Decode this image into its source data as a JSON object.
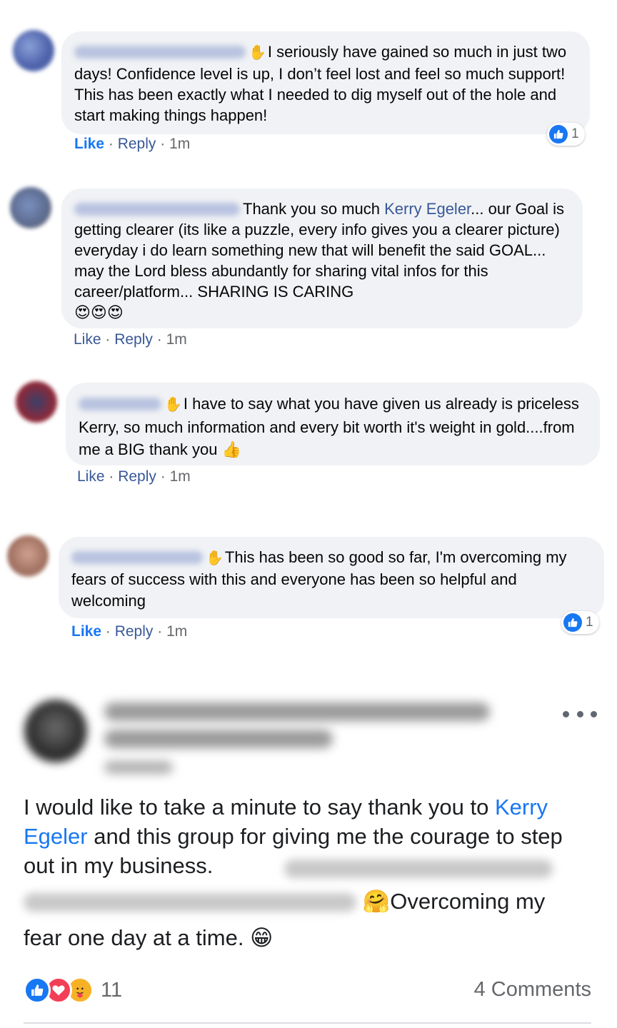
{
  "comments": [
    {
      "text": "I seriously have gained so much in just two days! Confidence level is up, I don’t feel lost and feel so much support! This has been exactly what I needed to dig myself out of the hole and start making things happen!",
      "like_label": "Like",
      "reply_label": "Reply",
      "time": "1m",
      "reaction_count": "1"
    },
    {
      "text_before": "Thank you so much ",
      "mention": "Kerry Egeler",
      "text_after": "... our Goal is getting clearer (its like a puzzle, every info gives you a clearer picture) everyday i do learn something new that will benefit the said GOAL... may the Lord bless abundantly for sharing vital infos for this career/platform... SHARING IS CARING",
      "emojis": "😍😍😍",
      "like_label": "Like",
      "reply_label": "Reply",
      "time": "1m"
    },
    {
      "text": "I have to say what you have given us already is priceless Kerry, so much information and every bit worth it's weight in gold....from me a BIG thank you",
      "emoji": "👍",
      "like_label": "Like",
      "reply_label": "Reply",
      "time": "1m"
    },
    {
      "text": "This has been so good so far, I'm overcoming my fears of success with this and everyone has been so helpful and welcoming",
      "like_label": "Like",
      "reply_label": "Reply",
      "time": "1m",
      "reaction_count": "1"
    }
  ],
  "post": {
    "text_1": "I would like to take a minute to say thank you to ",
    "mention": "Kerry Egeler",
    "text_2": " and this group for giving me the courage to step out in my business.",
    "emoji_hug": "🤗",
    "text_3": "Overcoming my",
    "text_4": "fear one day at a time.",
    "emoji_grin": "😁",
    "reaction_count": "11",
    "comments_label": "4 Comments"
  },
  "icons": {
    "like": "thumbs-up-icon",
    "love": "heart-icon",
    "care": "care-icon",
    "wave": "wave-icon",
    "more": "more-dots-icon"
  },
  "colors": {
    "bubble": "#f0f2f5",
    "link": "#385898",
    "facebook_blue": "#1877f2",
    "meta_gray": "#65676b"
  }
}
